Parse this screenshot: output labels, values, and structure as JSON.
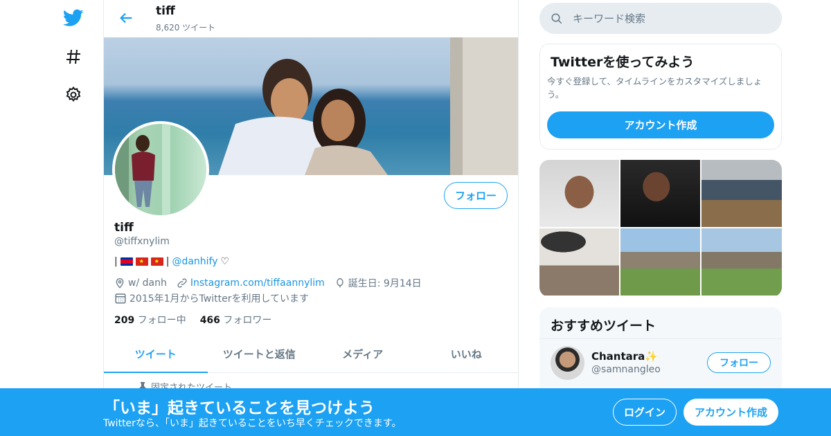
{
  "nav": {
    "icons": [
      "twitter-bird-icon",
      "hashtag-icon",
      "gear-icon"
    ]
  },
  "profile_header": {
    "name": "tiff",
    "tweet_count": "8,620 ツイート"
  },
  "profile": {
    "follow_label": "フォロー",
    "name": "tiff",
    "handle": "@tiffxnylim",
    "bio_prefix": "|",
    "bio_separator": "|",
    "bio_link": "@danhify",
    "bio_suffix": "♡",
    "location": "w/ danh",
    "website": "Instagram.com/tiffaannylim",
    "birthday": "誕生日: 9月14日",
    "joined": "2015年1月からTwitterを利用しています",
    "following_count": "209",
    "following_label": "フォロー中",
    "followers_count": "466",
    "followers_label": "フォロワー"
  },
  "tabs": [
    {
      "label": "ツイート",
      "active": true
    },
    {
      "label": "ツイートと返信",
      "active": false
    },
    {
      "label": "メディア",
      "active": false
    },
    {
      "label": "いいね",
      "active": false
    }
  ],
  "pinned_label": "固定されたツイート",
  "search": {
    "placeholder": "キーワード検索"
  },
  "signup_card": {
    "title": "Twitterを使ってみよう",
    "description": "今すぐ登録して、タイムラインをカスタマイズしましょう。",
    "button": "アカウント作成"
  },
  "recommended": {
    "title": "おすすめツイート",
    "users": [
      {
        "name": "Chantara✨",
        "handle": "@samnangleo",
        "follow_label": "フォロー"
      }
    ]
  },
  "bottom_bar": {
    "title": "「いま」起きていることを見つけよう",
    "subtitle": "Twitterなら、「いま」起きていることをいち早くチェックできます。",
    "login": "ログイン",
    "signup": "アカウント作成"
  },
  "colors": {
    "accent": "#1da1f2",
    "link": "#1b95e0",
    "muted": "#657786"
  }
}
